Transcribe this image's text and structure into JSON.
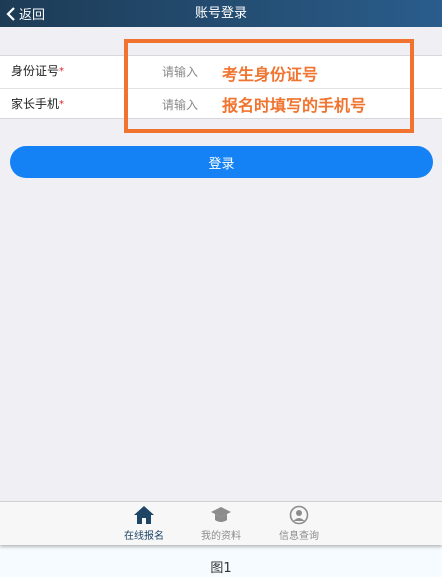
{
  "header": {
    "back_label": "返回",
    "title": "账号登录"
  },
  "form": {
    "fields": [
      {
        "label": "身份证号",
        "required_mark": "*",
        "placeholder": "请输入"
      },
      {
        "label": "家长手机",
        "required_mark": "*",
        "placeholder": "请输入"
      }
    ],
    "submit_label": "登录"
  },
  "annotations": [
    "考生身份证号",
    "报名时填写的手机号"
  ],
  "tabbar": {
    "items": [
      {
        "label": "在线报名",
        "icon": "home-icon",
        "active": true
      },
      {
        "label": "我的资料",
        "icon": "graduation-cap-icon",
        "active": false
      },
      {
        "label": "信息查询",
        "icon": "user-circle-icon",
        "active": false
      }
    ]
  },
  "caption": "图1",
  "colors": {
    "accent": "#1482f5",
    "annotation": "#f0742f",
    "header_dark": "#1d3b55",
    "required": "#e0232b"
  }
}
